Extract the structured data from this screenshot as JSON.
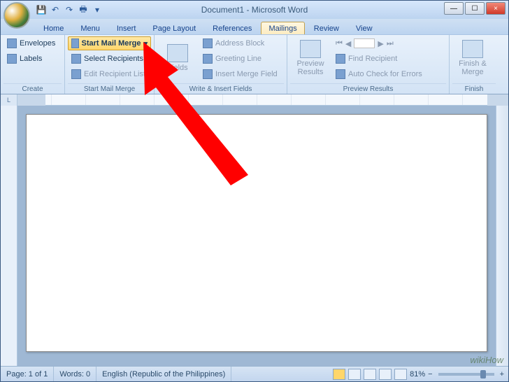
{
  "title": "Document1 - Microsoft Word",
  "tabs": [
    "Home",
    "Menu",
    "Insert",
    "Page Layout",
    "References",
    "Mailings",
    "Review",
    "View"
  ],
  "active_tab": "Mailings",
  "groups": {
    "create": {
      "label": "Create",
      "envelopes": "Envelopes",
      "labels": "Labels"
    },
    "start": {
      "label": "Start Mail Merge",
      "start_mm": "Start Mail Merge",
      "select_rec": "Select Recipients",
      "edit_rec": "Edit Recipient List"
    },
    "write": {
      "label": "Write & Insert Fields",
      "fields": "Fields",
      "addr_block": "Address Block",
      "greeting": "Greeting Line",
      "insert_mf": "Insert Merge Field"
    },
    "preview": {
      "label": "Preview Results",
      "preview": "Preview\nResults",
      "find": "Find Recipient",
      "auto_check": "Auto Check for Errors"
    },
    "finish": {
      "label": "Finish",
      "finish_merge": "Finish &\nMerge"
    }
  },
  "status": {
    "page": "Page: 1 of 1",
    "words": "Words: 0",
    "lang": "English (Republic of the Philippines)",
    "zoom": "81%"
  },
  "watermark": "wikiHow"
}
